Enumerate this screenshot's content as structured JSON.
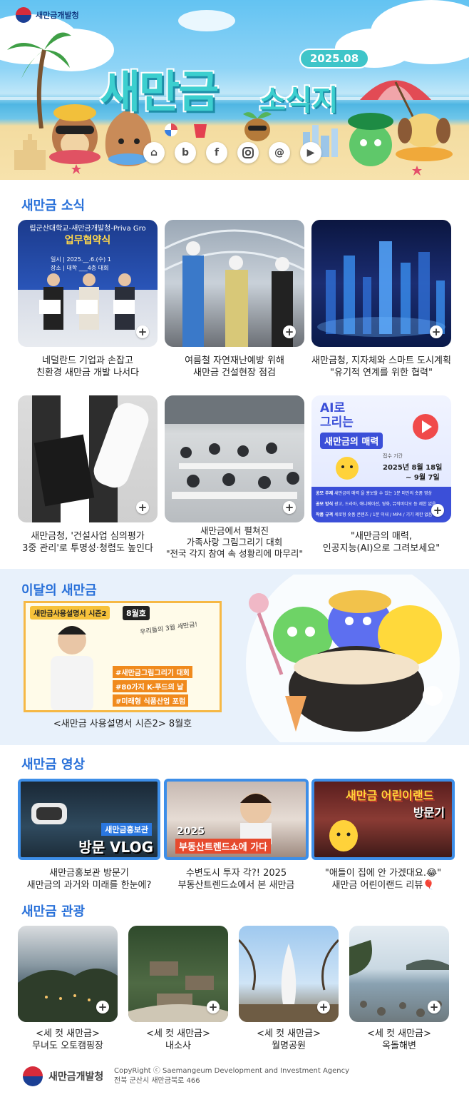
{
  "header": {
    "org_name": "새만금개발청",
    "date": "2025.08",
    "title_main": "새만금",
    "title_sub": "소식지",
    "social_icons": [
      "home-icon",
      "blog-icon",
      "facebook-icon",
      "instagram-icon",
      "threads-icon",
      "youtube-icon"
    ]
  },
  "news": {
    "title": "새만금 소식",
    "cards": [
      {
        "banner_line1": "립군산대학교-새만금개발청-Priva Gro",
        "banner_line2": "업무협약식",
        "banner_line3": "일시 | 2025.__.6.(수) 1",
        "banner_line4": "장소 | 대학 ___4층 대회",
        "line1": "네덜란드 기업과 손잡고",
        "line2": "친환경 새만금 개발 나서다"
      },
      {
        "line1": "여름철 자연재난예방 위해",
        "line2": "새만금 건설현장 점검"
      },
      {
        "line1": "새만금청, 지자체와 스마트 도시계획",
        "line2": "\"유기적 연계를 위한 협력\""
      },
      {
        "line1": "새만금청, '건설사업 심의평가",
        "line2": "3중 관리'로 투명성·청렴도 높인다"
      },
      {
        "line1": "새만금에서 펼쳐진",
        "line2": "가족사랑 그림그리기 대회",
        "line3": "\"전국 각지 참여 속 성황리에 마무리\""
      },
      {
        "poster_title1": "AI로",
        "poster_title2": "그리는",
        "poster_title3": "새만금의 매력",
        "poster_period_label": "접수 기간",
        "poster_date1": "2025년 8월 18일",
        "poster_date2": "~ 9월 7일",
        "poster_row1_tag": "공모 주제",
        "poster_row1_text": "새만금의 매력 을 홍보할 수 있는 1분 미만의 숏폼 영상",
        "poster_row2_tag": "공모 방식",
        "poster_row2_text": "광고, 드라마, 애니메이션, 영화, 뮤직비디오 등 제한 없음",
        "poster_row3_tag": "작품 규격",
        "poster_row3_text": "세로형 숏폼 콘텐츠 / 1분 이내 / MP4 / 기기 제한 없음",
        "line1": "\"새만금의 매력,",
        "line2": "인공지능(AI)으로 그려보세요\""
      }
    ]
  },
  "monthly": {
    "title": "이달의 새만금",
    "thumb_tag_series": "새만금사용설명서 시즌2",
    "thumb_tag_month": "8월호",
    "thumb_bubble": "우리들의 3월 새만금!",
    "thumb_hashtags": [
      "#새만금그림그리기 대회",
      "#80가지 K-푸드의 날",
      "#미래형 식품산업 포럼"
    ],
    "caption": "<새만금 사용설명서 시즌2> 8월호"
  },
  "videos": {
    "title": "새만금 영상",
    "items": [
      {
        "thumb_title1": "새만금홍보관",
        "thumb_title2": "방문 VLOG",
        "line1": "새만금홍보관 방문기",
        "line2": "새만금의 과거와 미래를 한눈에?"
      },
      {
        "thumb_title1": "2025",
        "thumb_title2": "부동산트렌드쇼에 가다",
        "line1": "수변도시 투자 각?! 2025",
        "line2": "부동산트렌드쇼에서 본 새만금"
      },
      {
        "thumb_title1": "새만금 어린이랜드",
        "thumb_title2": "방문기",
        "line1": "\"애들이 집에 안 가겠대요.😂\"",
        "line2": "새만금 어린이랜드 리뷰🎈"
      }
    ]
  },
  "tour": {
    "title": "새만금 관광",
    "items": [
      {
        "line1": "<세 컷 새만금>",
        "line2": "무녀도 오토캠핑장"
      },
      {
        "line1": "<세 컷 새만금>",
        "line2": "내소사"
      },
      {
        "line1": "<세 컷 새만금>",
        "line2": "월명공원"
      },
      {
        "line1": "<세 컷 새만금>",
        "line2": "옥돌해변"
      }
    ]
  },
  "footer": {
    "org_name": "새만금개발청",
    "copyright": "CopyRight ⓒ Saemangeum Development and Investment Agency",
    "address": "전북 군산시 새만금북로 466"
  },
  "colors": {
    "accent": "#2870d9",
    "video_border": "#3d8ee8",
    "title_teal": "#3ccfcf",
    "monthly_bg": "#e8f1fb"
  }
}
